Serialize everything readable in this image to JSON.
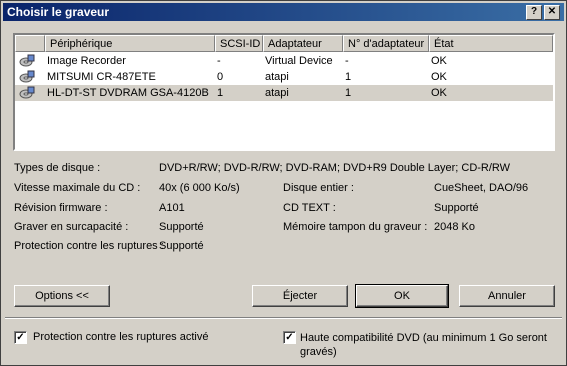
{
  "window": {
    "title": "Choisir le graveur",
    "help_glyph": "?",
    "close_glyph": "✕"
  },
  "list": {
    "headers": [
      "Périphérique",
      "SCSI-ID",
      "Adaptateur",
      "N° d'adaptateur",
      "État"
    ],
    "rows": [
      {
        "device": "Image Recorder",
        "scsi": "-",
        "adapter": "Virtual Device",
        "num": "-",
        "state": "OK"
      },
      {
        "device": "MITSUMI  CR-487ETE",
        "scsi": "0",
        "adapter": "atapi",
        "num": "1",
        "state": "OK"
      },
      {
        "device": "HL-DT-ST DVDRAM GSA-4120B",
        "scsi": "1",
        "adapter": "atapi",
        "num": "1",
        "state": "OK",
        "selected": true
      }
    ]
  },
  "info": {
    "disc_types_label": "Types de disque :",
    "disc_types_value": "DVD+R/RW; DVD-R/RW; DVD-RAM; DVD+R9 Double Layer; CD-R/RW",
    "max_speed_label": "Vitesse maximale du CD :",
    "max_speed_value": "40x (6 000 Ko/s)",
    "disc_whole_label": "Disque entier :",
    "disc_whole_value": "CueSheet, DAO/96",
    "firmware_label": "Révision firmware :",
    "firmware_value": "A101",
    "cd_text_label": "CD TEXT :",
    "cd_text_value": "Supporté",
    "overburn_label": "Graver en surcapacité :",
    "overburn_value": "Supporté",
    "buffer_label": "Mémoire tampon du graveur :",
    "buffer_value": "2048 Ko",
    "underrun_label": "Protection contre les ruptures :",
    "underrun_value": "Supporté"
  },
  "buttons": {
    "options": "Options <<",
    "eject": "Éjecter",
    "ok": "OK",
    "cancel": "Annuler"
  },
  "options": {
    "underrun_check_label": "Protection contre les ruptures activé",
    "underrun_checked": true,
    "dvd_compat_label": "Haute compatibilité DVD (au minimum 1 Go seront gravés)",
    "dvd_compat_checked": true,
    "check_glyph": "✓"
  }
}
